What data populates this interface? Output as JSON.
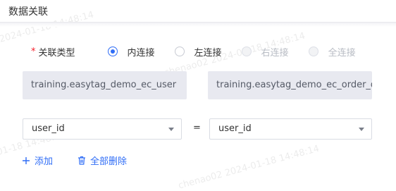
{
  "header": {
    "title": "数据关联"
  },
  "join_type": {
    "label": "关联类型",
    "options": [
      {
        "label": "内连接",
        "selected": true,
        "disabled": false
      },
      {
        "label": "左连接",
        "selected": false,
        "disabled": false
      },
      {
        "label": "右连接",
        "selected": false,
        "disabled": true
      },
      {
        "label": "全连接",
        "selected": false,
        "disabled": true
      }
    ]
  },
  "tables": {
    "left": "training.easytag_demo_ec_user",
    "right": "training.easytag_demo_ec_order_d"
  },
  "join_condition": {
    "left_field": "user_id",
    "operator": "=",
    "right_field": "user_id"
  },
  "actions": {
    "add_label": "添加",
    "delete_all_label": "全部删除"
  },
  "watermark": "chenao02 2024-01-18 14:48:14",
  "colors": {
    "accent": "#2f6df6",
    "required": "#f5222d",
    "table_bg": "#e8e9f0"
  },
  "icons": {
    "add": "plus-icon",
    "delete": "trash-icon",
    "dropdown": "caret-down-icon"
  }
}
